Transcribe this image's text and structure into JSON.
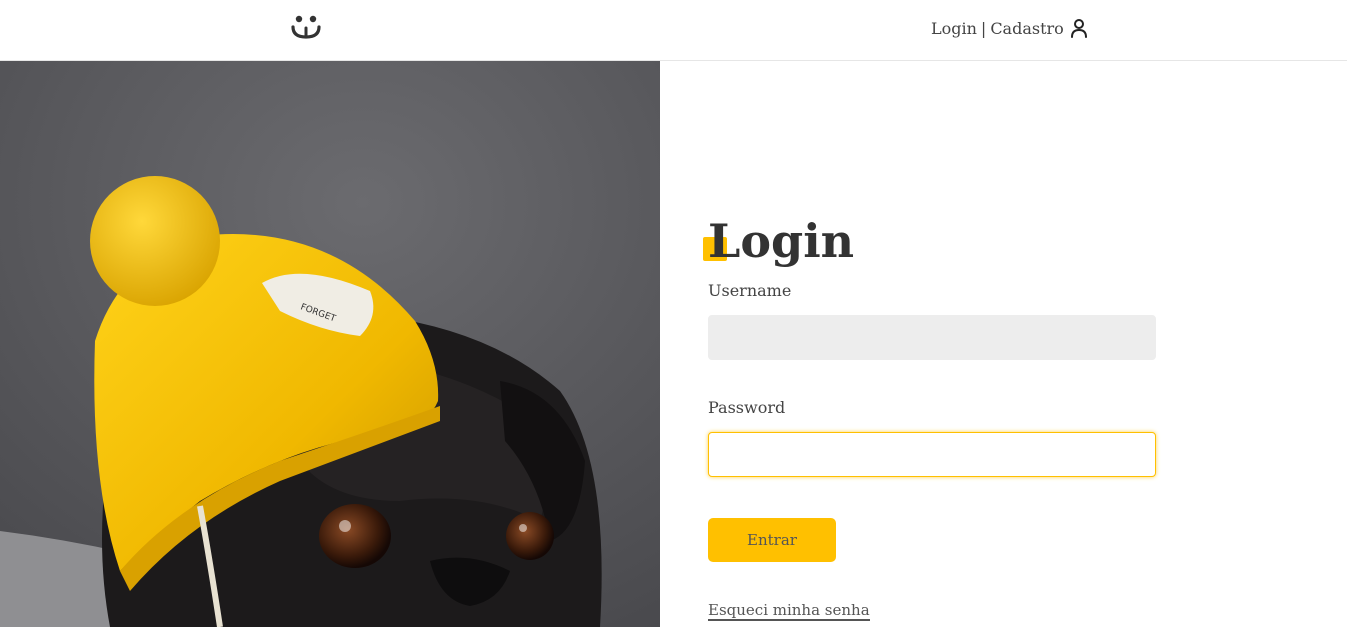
{
  "header": {
    "login_link": "Login",
    "separator": "|",
    "signup_link": "Cadastro",
    "user_icon": "user-icon",
    "logo_icon": "dog-face-logo-icon"
  },
  "form": {
    "title": "Login",
    "username_label": "Username",
    "username_value": "",
    "password_label": "Password",
    "password_value": "",
    "submit_label": "Entrar",
    "forgot_link": "Esqueci minha senha"
  },
  "colors": {
    "accent": "#ffc000",
    "text": "#444444",
    "input_bg": "#ededed"
  }
}
